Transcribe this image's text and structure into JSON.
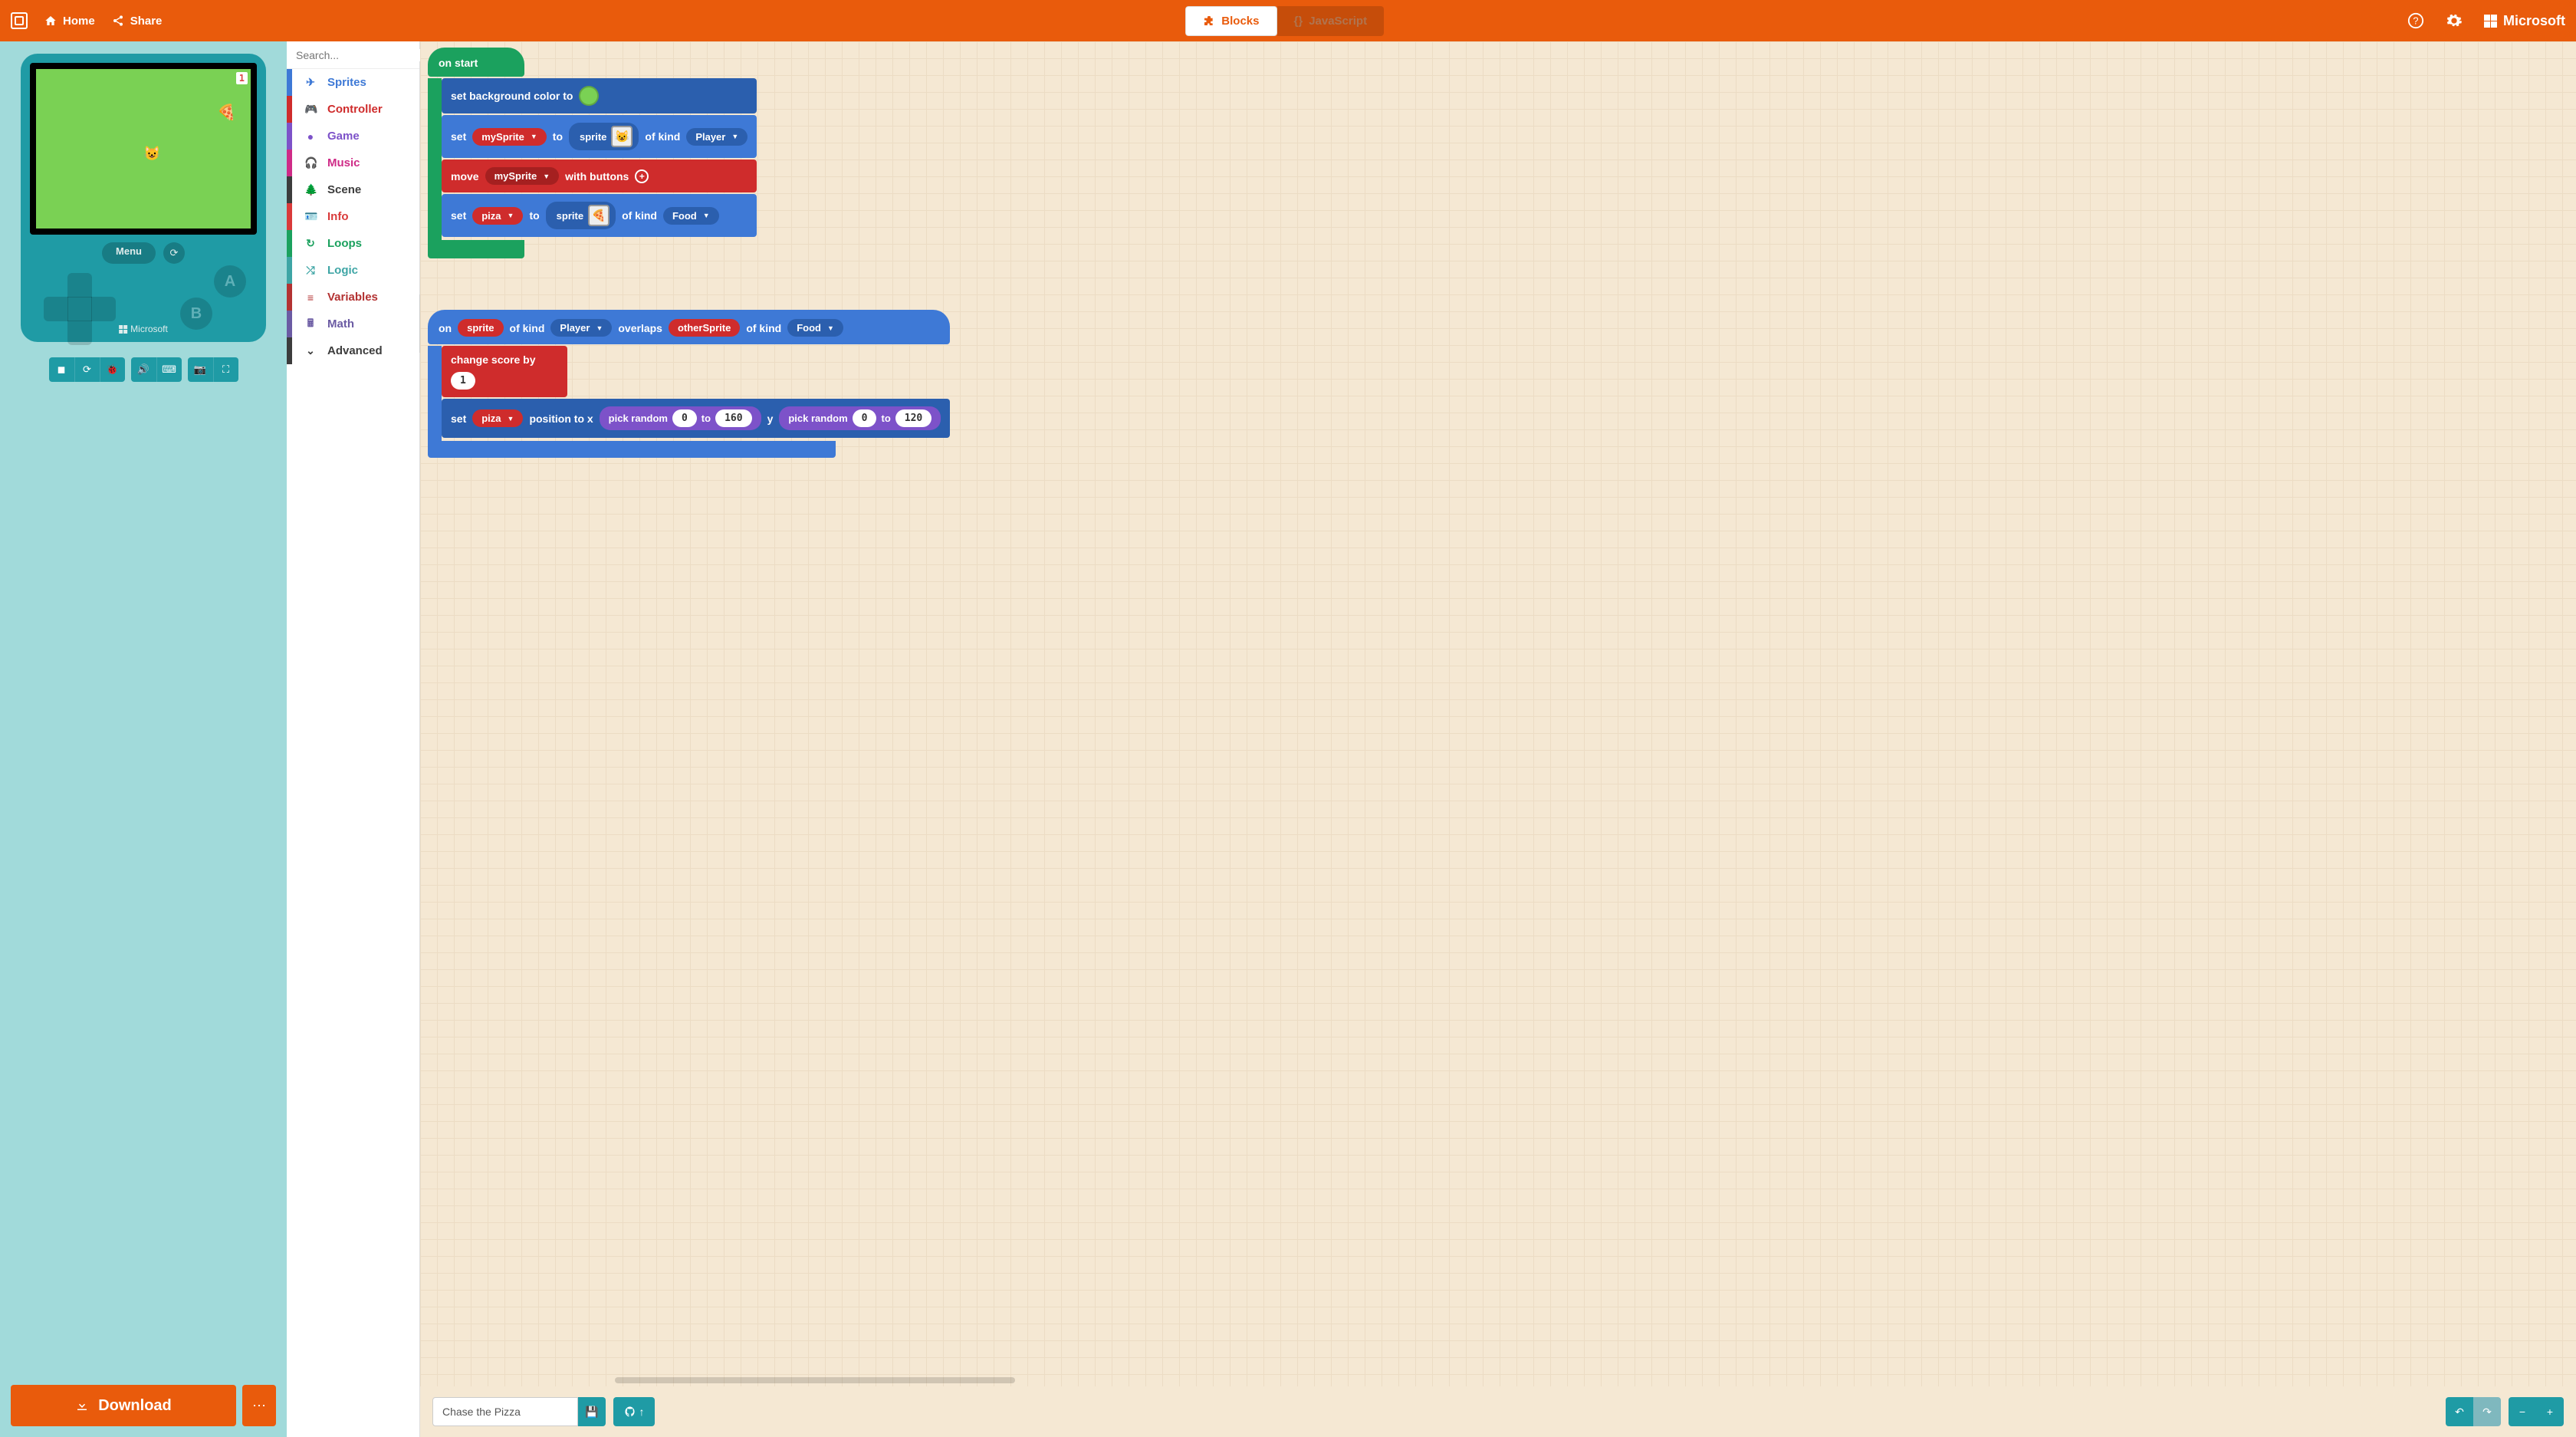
{
  "header": {
    "home_label": "Home",
    "share_label": "Share",
    "blocks_label": "Blocks",
    "javascript_label": "JavaScript",
    "brand": "Microsoft"
  },
  "simulator": {
    "score": "1",
    "menu_label": "Menu",
    "device_brand": "Microsoft",
    "button_a": "A",
    "button_b": "B"
  },
  "download": {
    "label": "Download"
  },
  "toolbox": {
    "search_placeholder": "Search...",
    "categories": {
      "sprites": "Sprites",
      "controller": "Controller",
      "game": "Game",
      "music": "Music",
      "scene": "Scene",
      "info": "Info",
      "loops": "Loops",
      "logic": "Logic",
      "variables": "Variables",
      "math": "Math",
      "advanced": "Advanced"
    }
  },
  "blocks": {
    "on_start": "on start",
    "set_bg_color_to": "set background color to",
    "bg_color": "#7AD154",
    "set": "set",
    "mySprite": "mySprite",
    "to": "to",
    "sprite": "sprite",
    "of_kind": "of kind",
    "player": "Player",
    "move": "move",
    "with_buttons": "with buttons",
    "piza": "piza",
    "food": "Food",
    "on": "on",
    "overlaps": "overlaps",
    "otherSprite": "otherSprite",
    "change_score_by": "change score by",
    "score_delta": "1",
    "position_to_x": "position to x",
    "pick_random": "pick random",
    "r1_from": "0",
    "r1_to": "160",
    "y": "y",
    "r2_from": "0",
    "r2_to": "120"
  },
  "bottom_bar": {
    "project_name": "Chase the Pizza"
  }
}
